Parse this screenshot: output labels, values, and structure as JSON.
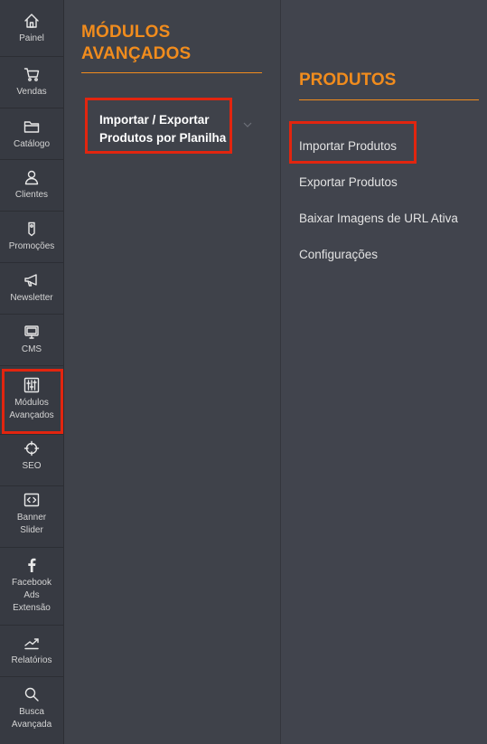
{
  "sidebar": {
    "items": [
      {
        "label": "Painel",
        "icon": "home-icon"
      },
      {
        "label": "Vendas",
        "icon": "cart-icon"
      },
      {
        "label": "Catálogo",
        "icon": "folder-icon"
      },
      {
        "label": "Clientes",
        "icon": "user-icon"
      },
      {
        "label": "Promoções",
        "icon": "tag-icon"
      },
      {
        "label": "Newsletter",
        "icon": "megaphone-icon"
      },
      {
        "label": "CMS",
        "icon": "monitor-icon"
      },
      {
        "label": "Módulos\nAvançados",
        "icon": "sliders-icon"
      },
      {
        "label": "SEO",
        "icon": "crosshair-icon"
      },
      {
        "label": "Banner\nSlider",
        "icon": "code-icon"
      },
      {
        "label": "Facebook\nAds\nExtensão",
        "icon": "facebook-icon"
      },
      {
        "label": "Relatórios",
        "icon": "trend-icon"
      },
      {
        "label": "Busca\nAvançada",
        "icon": "search-icon"
      }
    ]
  },
  "middle_panel": {
    "title": "MÓDULOS AVANÇADOS",
    "link_label": "Importar / Exportar Produtos por Planilha"
  },
  "right_panel": {
    "title": "PRODUTOS",
    "links": [
      "Importar Produtos",
      "Exportar Produtos",
      "Baixar Imagens de URL Ativa",
      "Configurações"
    ]
  },
  "colors": {
    "accent": "#f18c1d",
    "highlight": "#e2250f",
    "sidebar_bg": "#373a42",
    "panel_bg": "#41444d"
  }
}
